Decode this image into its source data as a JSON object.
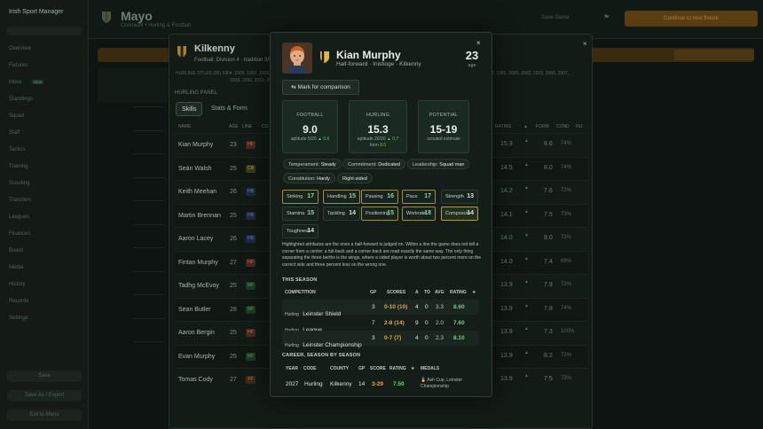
{
  "app": {
    "title": "Irish Sport Manager"
  },
  "sidebar": {
    "items": [
      "Overview",
      "Fixtures",
      "Inbox",
      "Standings",
      "Squad",
      "Staff",
      "Tactics",
      "Training",
      "Scouting",
      "Transfers",
      "Leagues",
      "Finances",
      "Board",
      "Media",
      "History",
      "Records",
      "Settings"
    ],
    "buttons": [
      "Save",
      "Save As / Export",
      "Exit to Menu"
    ],
    "badge": "NEW"
  },
  "topbar": {
    "county": "Mayo",
    "sub": "Connacht • Hurling & Football",
    "link": "Save Game",
    "continue_label": "Continue to next fixture"
  },
  "outer_panel": {
    "title": "Kilkenny",
    "subtitle": "Football: Division 4 · tradition 3/5",
    "hurling_titles": "HURLING TITLES (36)  1904, 1905, 1907, 1909, 1911, 1912, 1913, 1922, 1932, 1933, 1935, 1939, 1947, 1957, 1963, 1967",
    "hurling_titles_cont": "1969, 1972, 1974, 1975, 1979, 1982, 1983, 1992, 1993, 2000, 2002, 2003, 2006, 2007,",
    "hurling_titles_cont2": "2008, 2009, 2011, 2012, 2014, 2015",
    "section": "HURLING PANEL",
    "tabs": [
      "Skills",
      "Stats & Form"
    ],
    "columns": [
      "NAME",
      "AGE",
      "LINE",
      "CO",
      "RATING",
      "▲",
      "FORM",
      "COND",
      "INJ"
    ],
    "rows": [
      {
        "name": "Kian Murphy",
        "age": "23",
        "line": "HF",
        "rating": "15.3",
        "form": "8.6",
        "cond": "74%"
      },
      {
        "name": "Seán Walsh",
        "age": "25",
        "line": "CB",
        "rating": "14.5",
        "form": "8.0",
        "cond": "74%"
      },
      {
        "name": "Keith Meehan",
        "age": "26",
        "line": "HB",
        "rating": "14.2",
        "form": "7.6",
        "cond": "72%"
      },
      {
        "name": "Martin Brennan",
        "age": "25",
        "line": "HB",
        "rating": "14.1",
        "form": "7.5",
        "cond": "73%"
      },
      {
        "name": "Aaron Lacey",
        "age": "26",
        "line": "HB",
        "rating": "14.0",
        "form": "8.0",
        "cond": "73%"
      },
      {
        "name": "Fintan Murphy",
        "age": "27",
        "line": "HF",
        "rating": "14.0",
        "form": "7.4",
        "cond": "69%"
      },
      {
        "name": "Tadhg McEvoy",
        "age": "25",
        "line": "MF",
        "rating": "13.9",
        "form": "7.9",
        "cond": "73%"
      },
      {
        "name": "Sean Butler",
        "age": "28",
        "line": "MF",
        "rating": "13.9",
        "form": "7.8",
        "cond": "74%"
      },
      {
        "name": "Aaron Bergin",
        "age": "25",
        "line": "HF",
        "rating": "13.9",
        "form": "7.3",
        "cond": "100%"
      },
      {
        "name": "Evan Murphy",
        "age": "25",
        "line": "MF",
        "rating": "13.9",
        "form": "8.2",
        "cond": "73%"
      },
      {
        "name": "Tomas Cody",
        "age": "27",
        "line": "FF",
        "rating": "13.9",
        "form": "7.5",
        "cond": "73%"
      }
    ]
  },
  "modal": {
    "name": "Kian Murphy",
    "description": "Half-forward · Inistioge · Kilkenny",
    "age": "23",
    "age_label": "age",
    "compare_label": "Mark for comparison",
    "cards": [
      {
        "label": "FOOTBALL",
        "value": "9.0",
        "line1": "aptitude 5/20",
        "delta": "▲ 0.6",
        "line2": ""
      },
      {
        "label": "HURLING",
        "value": "15.3",
        "line1": "aptitude 20/20",
        "delta": "▲ 0.7",
        "line2": "form",
        "form": "8.0"
      },
      {
        "label": "POTENTIAL",
        "value": "15-19",
        "line1": "scouted estimate",
        "delta": "",
        "line2": ""
      }
    ],
    "traits": [
      {
        "k": "Temperament:",
        "v": "Steady"
      },
      {
        "k": "Commitment:",
        "v": "Dedicated"
      },
      {
        "k": "Leadership:",
        "v": "Squad man"
      },
      {
        "k": "Constitution:",
        "v": "Hardy"
      },
      {
        "k": "",
        "v": "Right-sided"
      }
    ],
    "attributes": [
      {
        "name": "Striking",
        "value": "17"
      },
      {
        "name": "Handling",
        "value": "15"
      },
      {
        "name": "Passing",
        "value": "16"
      },
      {
        "name": "Pace",
        "value": "17"
      },
      {
        "name": "Strength",
        "value": "13"
      },
      {
        "name": "Stamina",
        "value": "15"
      },
      {
        "name": "Tackling",
        "value": "14"
      },
      {
        "name": "Positioning",
        "value": "15"
      },
      {
        "name": "Workrate",
        "value": "18"
      },
      {
        "name": "Composure",
        "value": "14"
      },
      {
        "name": "Toughness",
        "value": "14"
      }
    ],
    "explanation": "Highlighted attributes are the ones a half-forward is judged on. Within a line the game does not tell a corner from a centre: a full-back and a corner-back are read exactly the same way. The only thing separating the three berths is the wings, where a sided player is worth about two percent more on the correct side and three percent less on the wrong one.",
    "this_season": {
      "title": "THIS SEASON",
      "columns": [
        "COMPETITION",
        "GP",
        "SCORES",
        "A",
        "TO",
        "AVG",
        "RATING",
        "★"
      ],
      "rows": [
        {
          "sport": "Hurling",
          "comp": "Leinster Shield",
          "gp": "3",
          "scores": "0-10 (10)",
          "a": "4",
          "to": "0",
          "avg": "3.3",
          "rating": "8.60"
        },
        {
          "sport": "Hurling",
          "comp": "League",
          "gp": "7",
          "scores": "2-8 (14)",
          "a": "9",
          "to": "0",
          "avg": "2.0",
          "rating": "7.60"
        },
        {
          "sport": "Hurling",
          "comp": "Leinster Championship",
          "gp": "3",
          "scores": "0-7 (7)",
          "a": "4",
          "to": "0",
          "avg": "2.3",
          "rating": "8.10"
        }
      ]
    },
    "career": {
      "title": "CAREER, SEASON BY SEASON",
      "columns": [
        "YEAR",
        "CODE",
        "COUNTY",
        "GP",
        "SCORE",
        "RATING",
        "★",
        "MEDALS"
      ],
      "rows": [
        {
          "year": "2027",
          "code": "Hurling",
          "county": "Kilkenny",
          "gp": "14",
          "score": "3-29",
          "rating": "7.50",
          "medals": "Ash Cup, Leinster Championship"
        }
      ]
    }
  },
  "colors": {
    "accent_green": "#6fd07f",
    "score_orange": "#e3a847",
    "highlight_border": "#a08c3a"
  }
}
